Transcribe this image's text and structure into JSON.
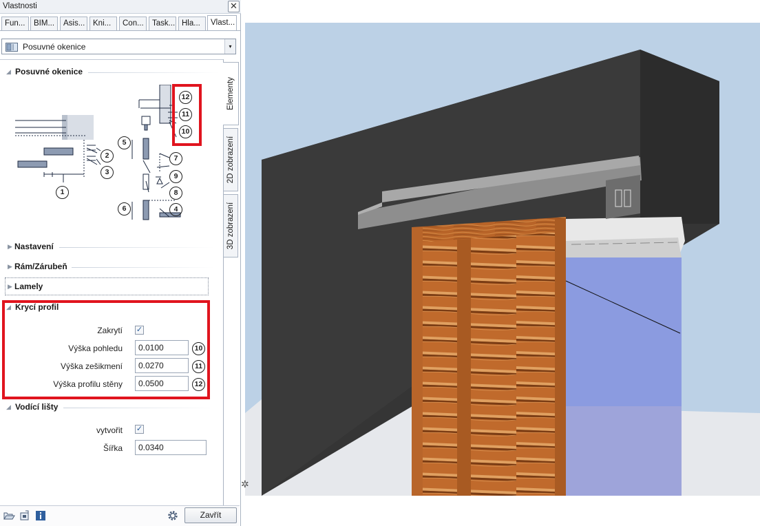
{
  "window": {
    "title": "Vlastnosti"
  },
  "tabs": [
    "Fun...",
    "BIM...",
    "Asis...",
    "Kni...",
    "Con...",
    "Task...",
    "Hla...",
    "Vlast..."
  ],
  "dropdown": {
    "value": "Posuvné okenice",
    "arrow": "▾"
  },
  "vertical_tabs": [
    "Elementy",
    "2D zobrazení",
    "3D zobrazení"
  ],
  "sections": {
    "posuvne_okenice": "Posuvné okenice",
    "nastaveni": "Nastavení",
    "ram": "Rám/Zárubeň",
    "lamely": "Lamely",
    "kryci_profil": "Krycí profil",
    "vodici_listy": "Vodící lišty"
  },
  "diagram": {
    "labels": [
      "12",
      "11",
      "10",
      "5",
      "2",
      "3",
      "1",
      "7",
      "9",
      "8",
      "6",
      "4"
    ]
  },
  "kryci_profil": {
    "zakryti_label": "Zakrytí",
    "zakryti_checked": true,
    "fields": [
      {
        "label": "Výška pohledu",
        "value": "0.0100",
        "badge": "10"
      },
      {
        "label": "Výška zešikmení",
        "value": "0.0270",
        "badge": "11"
      },
      {
        "label": "Výška profilu stěny",
        "value": "0.0500",
        "badge": "12"
      }
    ]
  },
  "vodici_listy": {
    "vytvorit_label": "vytvořit",
    "vytvorit_checked": true,
    "sirka_label": "Šířka",
    "sirka_value": "0.0340"
  },
  "footer": {
    "close_label": "Zavřít"
  },
  "colors": {
    "highlight": "#e0141e",
    "sky": "#bcd1e6",
    "wall": "#353535",
    "glass": "#8b9be0",
    "wood": "#b8652a"
  },
  "icons": {
    "checkmark": "✓",
    "triangle_expanded": "◢",
    "triangle_collapsed": "▶",
    "close": "✕"
  }
}
